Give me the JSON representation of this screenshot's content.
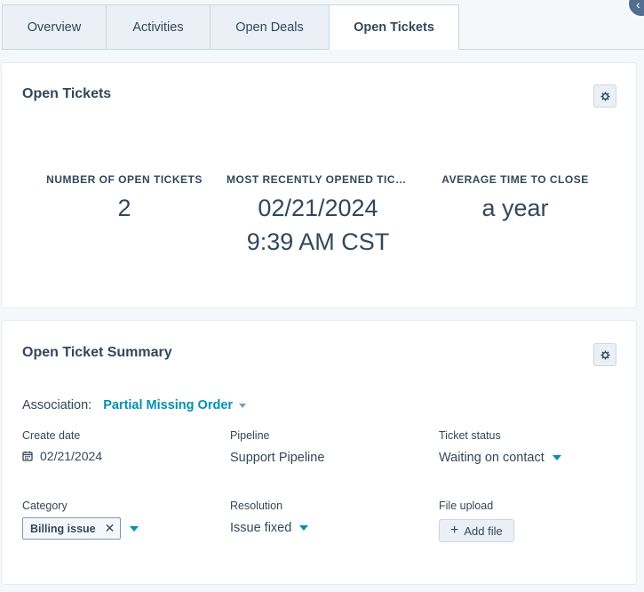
{
  "tabs": [
    {
      "label": "Overview"
    },
    {
      "label": "Activities"
    },
    {
      "label": "Open Deals"
    },
    {
      "label": "Open Tickets"
    }
  ],
  "open_tickets_card": {
    "title": "Open Tickets",
    "stats": [
      {
        "label": "NUMBER OF OPEN TICKETS",
        "value": "2"
      },
      {
        "label": "MOST RECENTLY OPENED TICK...",
        "value_line1": "02/21/2024",
        "value_line2": "9:39 AM CST"
      },
      {
        "label": "AVERAGE TIME TO CLOSE",
        "value": "a year"
      }
    ]
  },
  "summary_card": {
    "title": "Open Ticket Summary",
    "association_label": "Association:",
    "association_value": "Partial Missing Order",
    "fields": {
      "create_date": {
        "label": "Create date",
        "value": "02/21/2024"
      },
      "pipeline": {
        "label": "Pipeline",
        "value": "Support Pipeline"
      },
      "ticket_status": {
        "label": "Ticket status",
        "value": "Waiting on contact"
      },
      "category": {
        "label": "Category",
        "tag": "Billing issue"
      },
      "resolution": {
        "label": "Resolution",
        "value": "Issue fixed"
      },
      "file_upload": {
        "label": "File upload",
        "button": "Add file"
      }
    }
  },
  "colors": {
    "accent": "#0091ae",
    "text": "#33475b",
    "border": "#cbd6e2"
  }
}
